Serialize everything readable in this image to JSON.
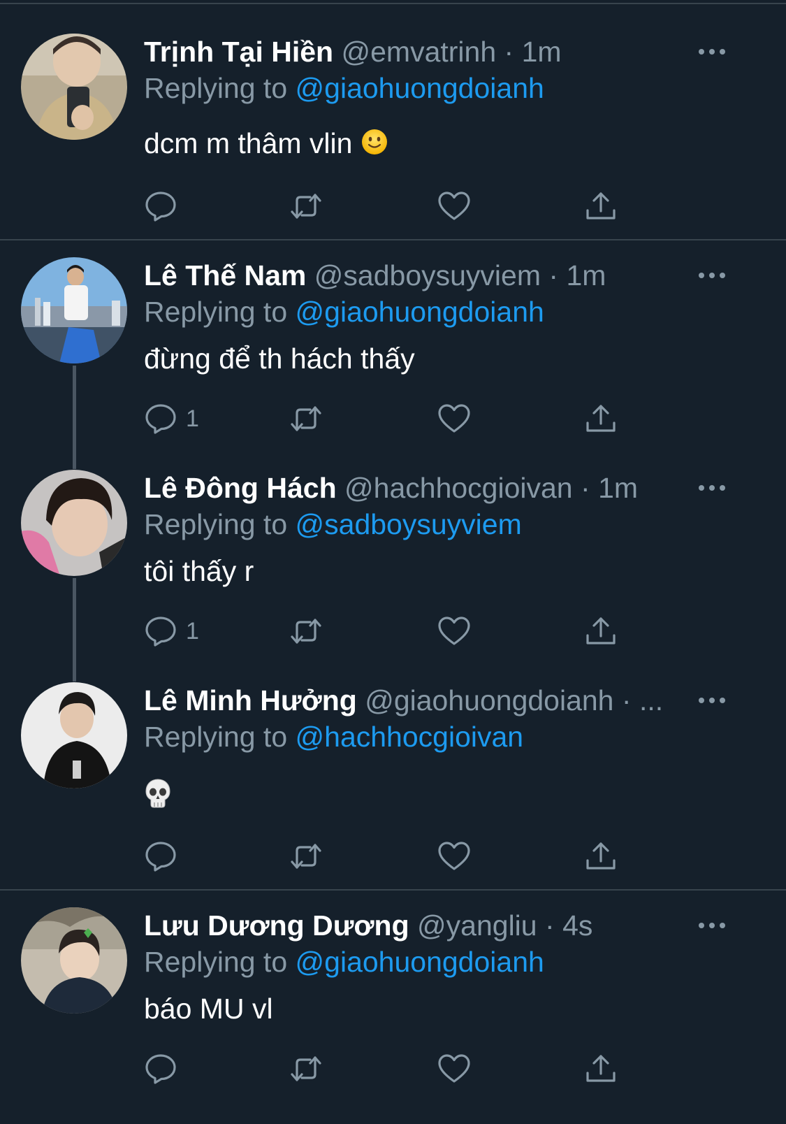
{
  "tweets": [
    {
      "name": "Trịnh Tại Hiền",
      "handle": "@emvatrinh",
      "separator": "·",
      "time": "1m",
      "replying_prefix": "Replying to",
      "replying_to": "@giaohuongdoianh",
      "text": "dcm m thâm vlin",
      "emoji": "slightly-smiling-face",
      "reply_count": ""
    },
    {
      "name": "Lê Thế Nam",
      "handle": "@sadboysuyviem",
      "separator": "·",
      "time": "1m",
      "replying_prefix": "Replying to",
      "replying_to": "@giaohuongdoianh",
      "text": "đừng để th hách thấy",
      "reply_count": "1"
    },
    {
      "name": "Lê Đông Hách",
      "handle": "@hachhocgioivan",
      "separator": "·",
      "time": "1m",
      "replying_prefix": "Replying to",
      "replying_to": "@sadboysuyviem",
      "text": "tôi thấy r",
      "reply_count": "1"
    },
    {
      "name": "Lê Minh Hưởng",
      "handle": "@giaohuongdoianh",
      "separator": "·",
      "time": "...",
      "replying_prefix": "Replying to",
      "replying_to": "@hachhocgioivan",
      "text": "",
      "emoji": "skull",
      "reply_count": ""
    },
    {
      "name": "Lưu Dương Dương",
      "handle": "@yangliu",
      "separator": "·",
      "time": "4s",
      "replying_prefix": "Replying to",
      "replying_to": "@giaohuongdoianh",
      "text": "báo MU vl",
      "reply_count": ""
    }
  ],
  "icons": {
    "reply": "reply-icon",
    "retweet": "retweet-icon",
    "like": "heart-icon",
    "share": "share-icon",
    "more": "more-options-icon"
  },
  "colors": {
    "background": "#15202b",
    "divider": "#38444d",
    "secondary_text": "#8899a6",
    "link": "#1d9bf0",
    "primary_text": "#ffffff"
  }
}
